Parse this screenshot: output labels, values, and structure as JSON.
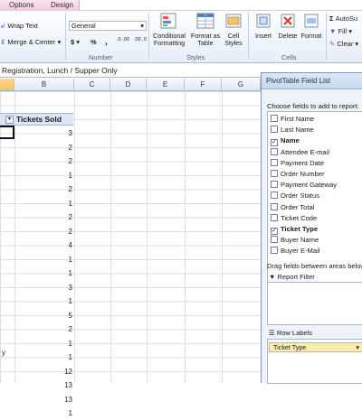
{
  "tabs": {
    "options": "Options",
    "design": "Design"
  },
  "ribbon": {
    "wrap_text": "Wrap Text",
    "merge_center": "Merge & Center",
    "number_format_value": "General",
    "currency_symbol": "$",
    "percent_symbol": "%",
    "comma_symbol": ",",
    "decimal_increase": ".0 .00",
    "decimal_decrease": ".00 .0",
    "conditional_formatting": "Conditional Formatting",
    "format_as_table": "Format as Table",
    "cell_styles": "Cell Styles",
    "insert": "Insert",
    "delete": "Delete",
    "format": "Format",
    "autosum": "AutoSu",
    "fill": "Fill",
    "clear": "Clear",
    "groups": {
      "number": "Number",
      "styles": "Styles",
      "cells": "Cells"
    }
  },
  "formula_bar": {
    "content": "Registration, Lunch / Supper Only"
  },
  "grid": {
    "columns": [
      "B",
      "C",
      "D",
      "E",
      "F",
      "G"
    ],
    "header_cell": "Tickets Sold",
    "tickets_sold": [
      "3",
      "2",
      "2",
      "1",
      "2",
      "1",
      "2",
      "2",
      "4",
      "1",
      "1",
      "3",
      "1",
      "5",
      "2",
      "1",
      "1",
      "12",
      "13",
      "13",
      "1"
    ],
    "col_a_text": "y"
  },
  "pivot": {
    "title": "PivotTable Field List",
    "choose_label": "Choose fields to add to report:",
    "fields": [
      {
        "name": "First Name",
        "checked": false
      },
      {
        "name": "Last Name",
        "checked": false
      },
      {
        "name": "Name",
        "checked": true
      },
      {
        "name": "Attendee E-mail",
        "checked": false
      },
      {
        "name": "Payment Date",
        "checked": false
      },
      {
        "name": "Order Number",
        "checked": false
      },
      {
        "name": "Payment Gateway",
        "checked": false
      },
      {
        "name": "Order Status",
        "checked": false
      },
      {
        "name": "Order Total",
        "checked": false
      },
      {
        "name": "Ticket Code",
        "checked": false
      },
      {
        "name": "Ticket Type",
        "checked": true
      },
      {
        "name": "Buyer Name",
        "checked": false
      },
      {
        "name": "Buyer E-Mail",
        "checked": false
      }
    ],
    "drag_label": "Drag fields between areas below:",
    "report_filter": "Report Filter",
    "row_labels": "Row Labels",
    "row_label_field": "Ticket Type"
  }
}
